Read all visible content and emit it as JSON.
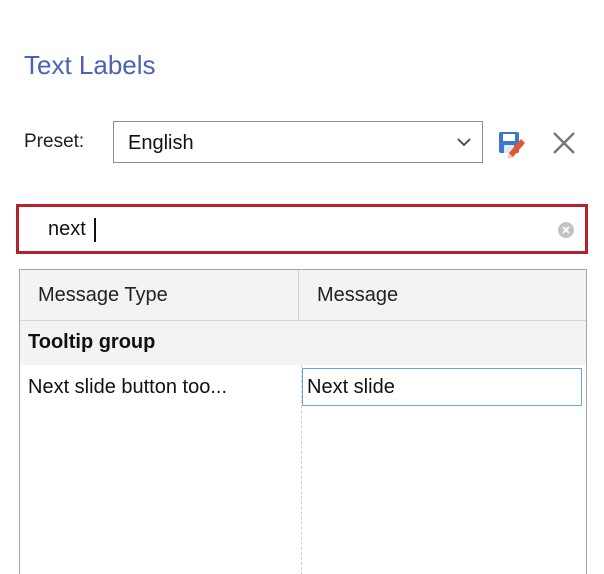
{
  "panel": {
    "title": "Text Labels"
  },
  "preset": {
    "label": "Preset:",
    "value": "English",
    "save_icon": "save-edit-icon",
    "close_icon": "close-icon"
  },
  "search": {
    "value": "next",
    "placeholder": "",
    "clear_icon": "clear-circle-icon"
  },
  "table": {
    "columns": [
      "Message Type",
      "Message"
    ],
    "group": "Tooltip group",
    "rows": [
      {
        "type": "Next slide button too...",
        "message": "Next slide"
      }
    ]
  },
  "colors": {
    "title": "#4a63b5",
    "search_border": "#b3232b",
    "selected_cell_border": "#6ea7de"
  }
}
